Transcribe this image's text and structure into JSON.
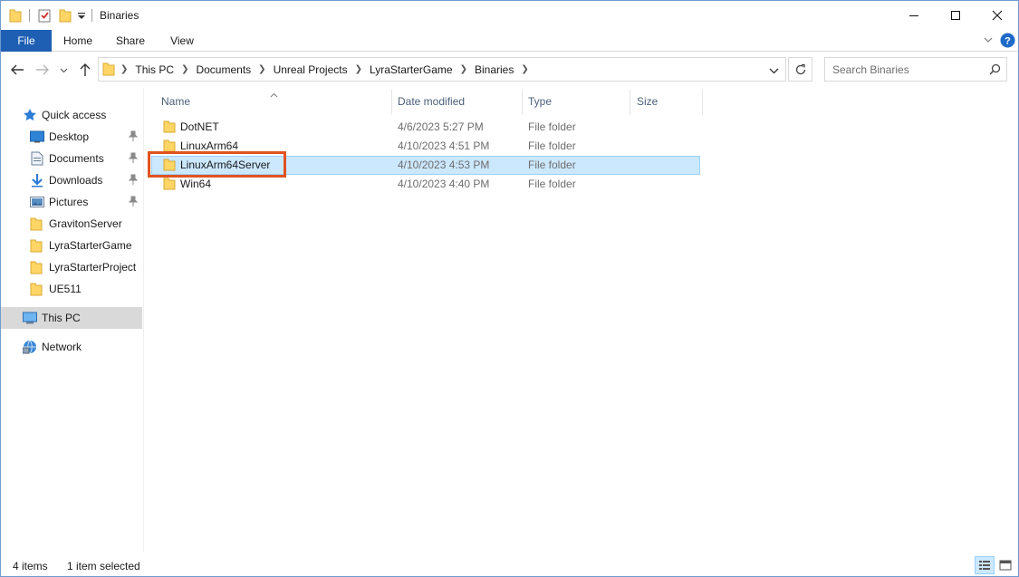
{
  "window": {
    "title": "Binaries"
  },
  "ribbon": {
    "tabs": [
      "File",
      "Home",
      "Share",
      "View"
    ]
  },
  "address": {
    "crumbs": [
      "This PC",
      "Documents",
      "Unreal Projects",
      "LyraStarterGame",
      "Binaries"
    ]
  },
  "search": {
    "placeholder": "Search Binaries"
  },
  "navpane": {
    "quick_access": "Quick access",
    "pinned": [
      {
        "label": "Desktop",
        "icon": "desktop-icon"
      },
      {
        "label": "Documents",
        "icon": "documents-icon"
      },
      {
        "label": "Downloads",
        "icon": "downloads-icon"
      },
      {
        "label": "Pictures",
        "icon": "pictures-icon"
      }
    ],
    "folders": [
      "GravitonServer",
      "LyraStarterGame",
      "LyraStarterProject",
      "UE511"
    ],
    "this_pc": "This PC",
    "network": "Network"
  },
  "columns": {
    "name": "Name",
    "date": "Date modified",
    "type": "Type",
    "size": "Size"
  },
  "files": [
    {
      "name": "DotNET",
      "date": "4/6/2023 5:27 PM",
      "type": "File folder"
    },
    {
      "name": "LinuxArm64",
      "date": "4/10/2023 4:51 PM",
      "type": "File folder"
    },
    {
      "name": "LinuxArm64Server",
      "date": "4/10/2023 4:53 PM",
      "type": "File folder"
    },
    {
      "name": "Win64",
      "date": "4/10/2023 4:40 PM",
      "type": "File folder"
    }
  ],
  "status": {
    "items": "4 items",
    "selected": "1 item selected"
  },
  "colors": {
    "file_tab": "#1e5fb3",
    "selection": "#cce8ff",
    "highlight_box": "#e0531f",
    "folder": "#ffd666"
  }
}
